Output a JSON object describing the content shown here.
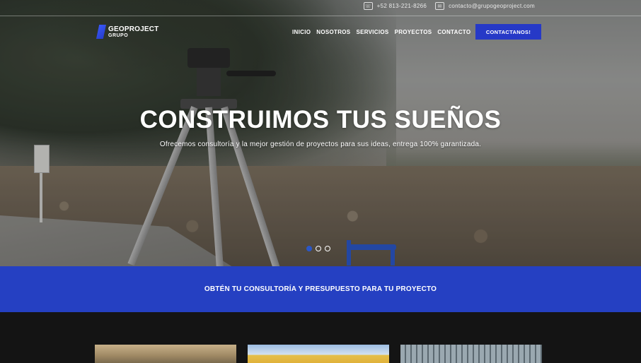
{
  "topbar": {
    "phone_icon": "phone-icon",
    "phone": "+52 813-221-8266",
    "email_icon": "mail-icon",
    "email": "contacto@grupogeoproject.com"
  },
  "logo": {
    "line1": "GEOPROJECT",
    "line2": "GRUPO"
  },
  "nav": {
    "items": [
      "INICIO",
      "NOSOTROS",
      "SERVICIOS",
      "PROYECTOS",
      "CONTACTO"
    ],
    "cta": "CONTACTANOS!"
  },
  "hero": {
    "title": "CONSTRUIMOS TUS SUEÑOS",
    "subtitle": "Ofrecemos consultoría y la mejor gestión de proyectos para sus ideas, entrega 100% garantizada.",
    "slide_count": 3,
    "active_slide": 1
  },
  "band": {
    "text": "OBTÉN TU CONSULTORÍA Y PRESUPUESTO PARA TU PROYECTO"
  },
  "colors": {
    "accent": "#2540c2",
    "dark_bg": "#141414"
  }
}
